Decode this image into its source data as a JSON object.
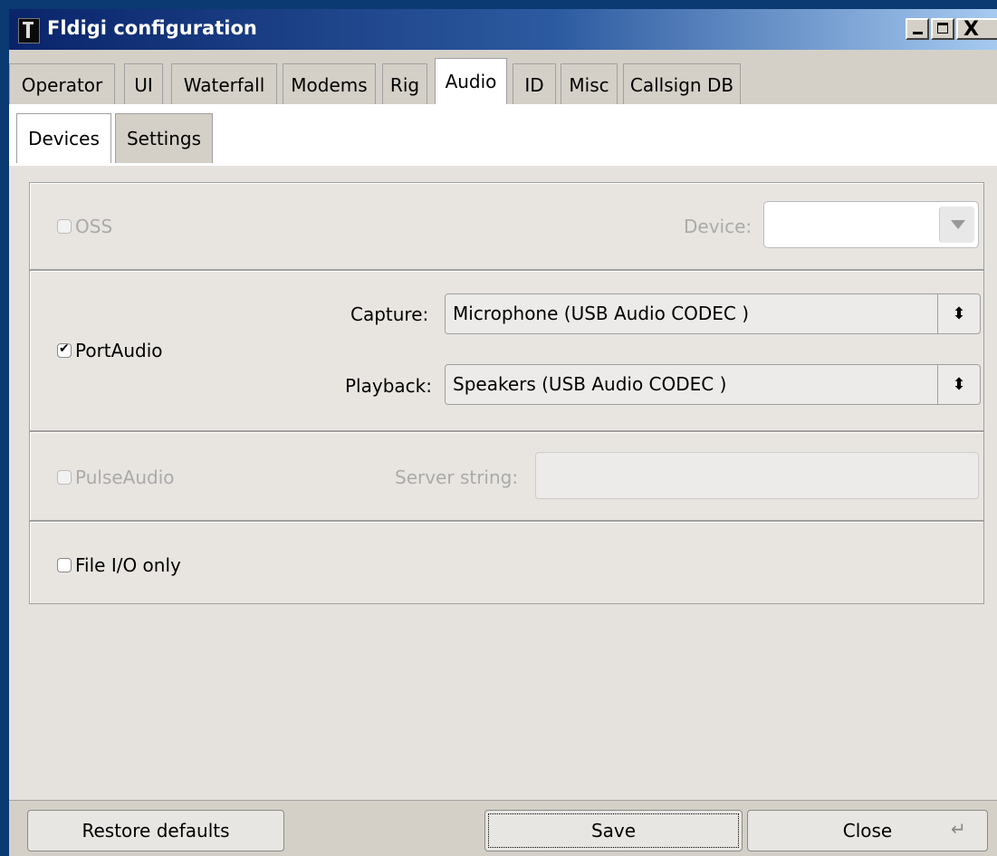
{
  "window": {
    "title": "Fldigi configuration"
  },
  "titlebar_buttons": {
    "minimize": "_",
    "maximize": "□",
    "close": "X"
  },
  "tabs": [
    {
      "label": "Operator",
      "active": false
    },
    {
      "label": "UI",
      "active": false
    },
    {
      "label": "Waterfall",
      "active": false
    },
    {
      "label": "Modems",
      "active": false
    },
    {
      "label": "Rig",
      "active": false
    },
    {
      "label": "Audio",
      "active": true
    },
    {
      "label": "ID",
      "active": false
    },
    {
      "label": "Misc",
      "active": false
    },
    {
      "label": "Callsign DB",
      "active": false
    }
  ],
  "subtabs": [
    {
      "label": "Devices",
      "active": true
    },
    {
      "label": "Settings",
      "active": false
    }
  ],
  "oss": {
    "label": "OSS",
    "checked": false,
    "enabled": false,
    "device_label": "Device:",
    "device_value": ""
  },
  "portaudio": {
    "label": "PortAudio",
    "checked": true,
    "enabled": true,
    "capture_label": "Capture:",
    "capture_value": "Microphone (USB Audio CODEC )",
    "playback_label": "Playback:",
    "playback_value": "Speakers (USB Audio CODEC )"
  },
  "pulseaudio": {
    "label": "PulseAudio",
    "checked": false,
    "enabled": false,
    "server_label": "Server string:",
    "server_value": ""
  },
  "fileio": {
    "label": "File I/O only",
    "checked": false,
    "enabled": true
  },
  "footer": {
    "restore_label": "Restore defaults",
    "save_label": "Save",
    "close_label": "Close"
  }
}
